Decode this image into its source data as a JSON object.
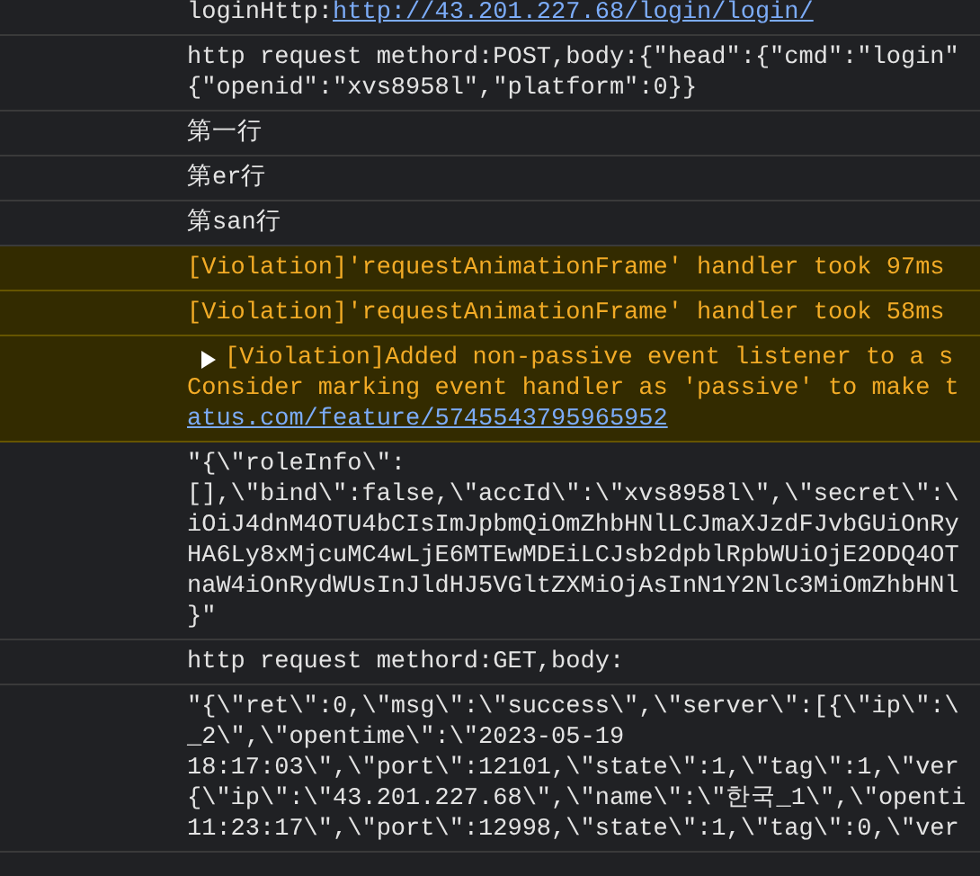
{
  "messages": [
    {
      "kind": "log",
      "lines": [
        "loginHttp:"
      ],
      "link": "http://43.201.227.68/login/login/"
    },
    {
      "kind": "log",
      "lines": [
        "http request methord:POST,body:{\"head\":{\"cmd\":\"login\"",
        "{\"openid\":\"xvs8958l\",\"platform\":0}}"
      ]
    },
    {
      "kind": "log",
      "lines": [
        "第一行"
      ]
    },
    {
      "kind": "log",
      "lines": [
        "第er行"
      ]
    },
    {
      "kind": "log",
      "lines": [
        "第san行"
      ]
    },
    {
      "kind": "warning",
      "lines": [
        "[Violation]'requestAnimationFrame' handler took 97ms"
      ]
    },
    {
      "kind": "warning",
      "lines": [
        "[Violation]'requestAnimationFrame' handler took 58ms"
      ]
    },
    {
      "kind": "warning",
      "expanded": false,
      "lines": [
        "[Violation]Added non-passive event listener to a s",
        "Consider marking event handler as 'passive' to make t"
      ],
      "link": "atus.com/feature/5745543795965952"
    },
    {
      "kind": "log",
      "lines": [
        "\"{\\\"roleInfo\\\":",
        "[],\\\"bind\\\":false,\\\"accId\\\":\\\"xvs8958l\\\",\\\"secret\\\":\\",
        "iOiJ4dnM4OTU4bCIsImJpbmQiOmZhbHNlLCJmaXJzdFJvbGUiOnRy",
        "HA6Ly8xMjcuMC4wLjE6MTEwMDEiLCJsb2dpblRpbWUiOjE2ODQ4OT",
        "naW4iOnRydWUsInJldHJ5VGltZXMiOjAsInN1Y2Nlc3MiOmZhbHNl",
        "}\""
      ]
    },
    {
      "kind": "log",
      "lines": [
        "http request methord:GET,body:"
      ]
    },
    {
      "kind": "log",
      "lines": [
        "\"{\\\"ret\\\":0,\\\"msg\\\":\\\"success\\\",\\\"server\\\":[{\\\"ip\\\":\\",
        "_2\\\",\\\"opentime\\\":\\\"2023-05-19",
        "18:17:03\\\",\\\"port\\\":12101,\\\"state\\\":1,\\\"tag\\\":1,\\\"ver",
        "{\\\"ip\\\":\\\"43.201.227.68\\\",\\\"name\\\":\\\"한국_1\\\",\\\"openti",
        "11:23:17\\\",\\\"port\\\":12998,\\\"state\\\":1,\\\"tag\\\":0,\\\"ver"
      ]
    }
  ]
}
